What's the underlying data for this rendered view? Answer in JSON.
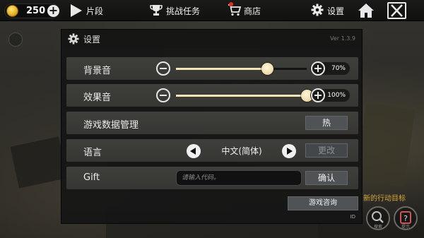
{
  "topbar": {
    "coins": "250",
    "nav": [
      {
        "label": "片段",
        "icon": "play-icon"
      },
      {
        "label": "挑战任务",
        "icon": "trophy-icon"
      },
      {
        "label": "商店",
        "icon": "cart-icon"
      },
      {
        "label": "设置",
        "icon": "gear-icon"
      }
    ]
  },
  "dialog": {
    "title": "设置",
    "version": "Ver 1.3.9",
    "bgm": {
      "label": "背景音",
      "percent": "70%",
      "value": 0.7
    },
    "sfx": {
      "label": "效果音",
      "percent": "100%",
      "value": 1.0
    },
    "data_mgmt": {
      "label": "游戏数据管理",
      "button": "热"
    },
    "language": {
      "label": "语言",
      "value": "中文(简体)",
      "change": "更改"
    },
    "gift": {
      "label": "Gift",
      "placeholder": "请输入代码。",
      "confirm": "确认"
    },
    "consult": "游戏咨询",
    "id": "ID"
  },
  "hud": {
    "text": "新的行动目标",
    "search_label": "搜索",
    "hint_label": "提示"
  }
}
